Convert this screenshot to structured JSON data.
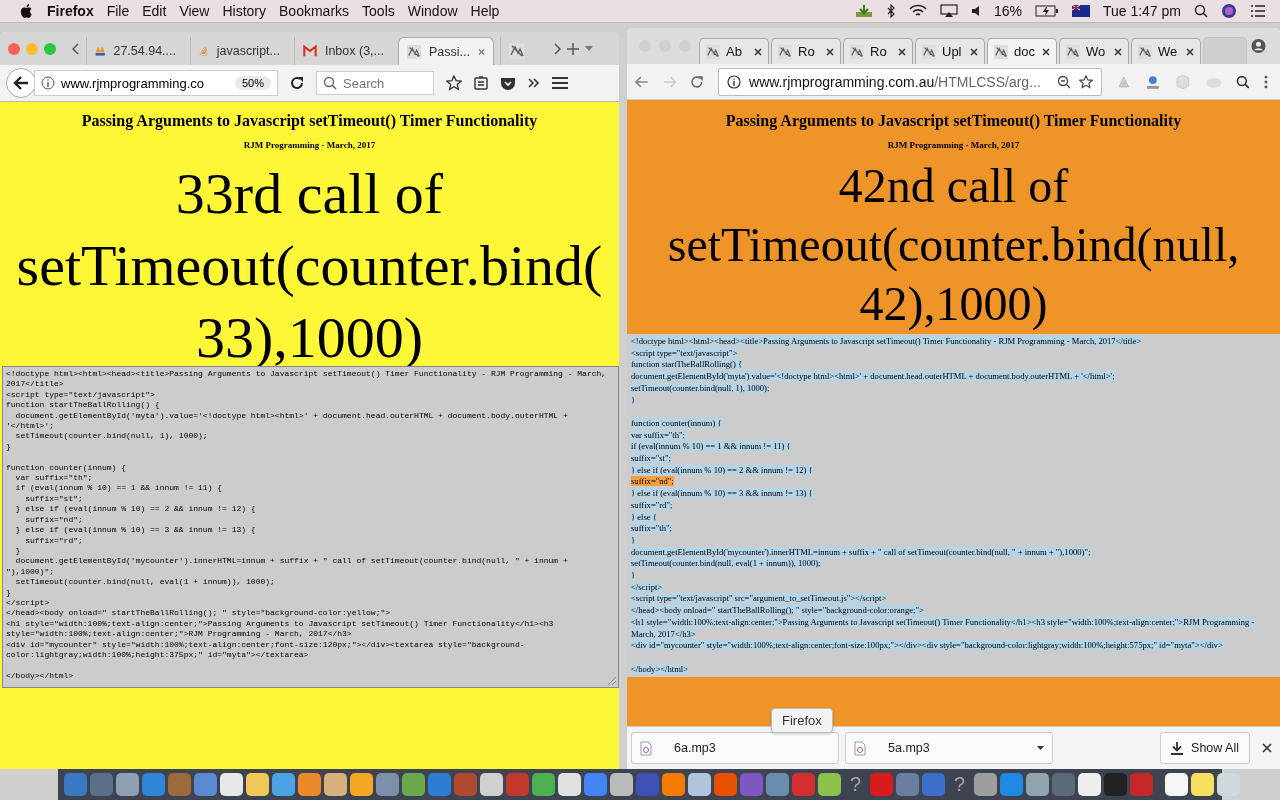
{
  "menu_bar": {
    "app": "Firefox",
    "menus": [
      "File",
      "Edit",
      "View",
      "History",
      "Bookmarks",
      "Tools",
      "Window",
      "Help"
    ],
    "battery": "16%",
    "clock": "Tue 1:47 pm"
  },
  "firefox_window": {
    "tabs": [
      {
        "label": "27.54.94....",
        "kind": "pma",
        "selected": false
      },
      {
        "label": "javascript...",
        "kind": "stack",
        "selected": false
      },
      {
        "label": "Inbox (3,...",
        "kind": "mail",
        "selected": false
      },
      {
        "label": "Passi...",
        "kind": "site",
        "selected": true
      }
    ],
    "address": "www.rjmprogramming.co",
    "zoom": "50%",
    "search": {
      "placeholder": "Search"
    },
    "page": {
      "heading": "Passing Arguments to Javascript setTimeout() Timer Functionality",
      "subheading": "RJM Programming - March, 2017",
      "counter_lines": [
        "33rd call of",
        "setTimeout(counter.bind(",
        "33),1000)"
      ],
      "code": "<!doctype html><html><head><title>Passing Arguments to Javascript setTimeout() Timer Functionality - RJM Programming - March, 2017</title>\n<script type=\"text/javascript\">\nfunction startTheBallRolling() {\n  document.getElementById('myta').value='<!doctype html><html>' + document.head.outerHTML + document.body.outerHTML + '</html>';\n  setTimeout(counter.bind(null, 1), 1000);\n}\n\nfunction counter(innum) {\n  var suffix=\"th\";\n  if (eval(innum % 10) == 1 && innum != 11) {\n    suffix=\"st\";\n  } else if (eval(innum % 10) == 2 && innum != 12) {\n    suffix=\"nd\";\n  } else if (eval(innum % 10) == 3 && innum != 13) {\n    suffix=\"rd\";\n  }\n  document.getElementById('mycounter').innerHTML=innum + suffix + \" call of setTimeout(counter.bind(null, \" + innum + \"),1000)\";\n  setTimeout(counter.bind(null, eval(1 + innum)), 1000);\n}\n</script>\n</head><body onload=\" startTheBallRolling(); \" style=\"background-color:yellow;\">\n<h1 style=\"width:100%;text-align:center;\">Passing Arguments to Javascript setTimeout() Timer Functionality</h1><h3 style=\"width:100%;text-align:center;\">RJM Programming - March, 2017</h3>\n<div id=\"mycounter\" style=\"width:100%;text-align:center;font-size:120px;\"></div><textarea style=\"background-color:lightgray;width:100%;height:375px;\" id=\"myta\"></textarea>\n\n</body></html>"
    }
  },
  "chrome_window": {
    "tabs": [
      {
        "label": "Ab",
        "selected": false
      },
      {
        "label": "Ro",
        "selected": false
      },
      {
        "label": "Ro",
        "selected": false
      },
      {
        "label": "Upl",
        "selected": false
      },
      {
        "label": "doc",
        "selected": true
      },
      {
        "label": "Wo",
        "selected": false
      },
      {
        "label": "We",
        "selected": false
      }
    ],
    "address_host": "www.rjmprogramming.com.au",
    "address_path": "/HTMLCSS/arg...",
    "page": {
      "heading": "Passing Arguments to Javascript setTimeout() Timer Functionality",
      "subheading": "RJM Programming - March, 2017",
      "counter_lines": [
        "42nd call of",
        "setTimeout(counter.bind(null,",
        "42),1000)"
      ],
      "code_blocks": [
        {
          "text": "<!doctype html><html><head><title>Passing Arguments to Javascript setTimeout() Timer Functionality - RJM Programming - March, 2017</title>\n<script type=\"text/javascript\">\nfunction startTheBallRolling() {\ndocument.getElementById('myta').value='<!doctype html><html>' + document.head.outerHTML + document.body.outerHTML + '</html>';\nsetTimeout(counter.bind(null, 1), 1000);\n}\n\nfunction counter(innum) {\nvar suffix=\"th\";\nif (eval(innum % 10) == 1 && innum != 11) {\nsuffix=\"st\";\n} else if (eval(innum % 10) == 2 && innum != 12) {\n",
          "match": false
        },
        {
          "text": "suffix=\"nd\";",
          "match": true
        },
        {
          "text": "\n} else if (eval(innum % 10) == 3 && innum != 13) {\nsuffix=\"rd\";\n} else {\nsuffix=\"th\";\n}\ndocument.getElementById('mycounter').innerHTML=innum + suffix + \" call of setTimeout(counter.bind(null, \" + innum + \"),1000)\";\nsetTimeout(counter.bind(null, eval(1 + innum)), 1000);\n}\n</script>\n<script type=\"text/javascript\" src=\"argument_to_setTimeout.js\"></script>\n</head><body onload=\" startTheBallRolling(); \" style=\"background-color:orange;\">\n<h1 style=\"width:100%;text-align:center;\">Passing Arguments to Javascript setTimeout() Timer Functionality</h1><h3 style=\"width:100%;text-align:center;\">RJM Programming - March, 2017</h3>\n<div id=\"mycounter\" style=\"width:100%;text-align:center;font-size:100px;\"></div><div style=\"background-color:lightgray;width:100%;height:575px;\" id=\"myta\"></div>\n\n</body></html>",
          "match": false
        }
      ]
    },
    "downloads": [
      {
        "file": "6a.mp3"
      },
      {
        "file": "5a.mp3"
      }
    ],
    "show_all": "Show All"
  },
  "tooltip": "Firefox",
  "dock": [
    {
      "kind": "app",
      "color": "#3a78c2"
    },
    {
      "kind": "app",
      "color": "#5a6f8a"
    },
    {
      "kind": "app",
      "color": "#8fa0b5"
    },
    {
      "kind": "app",
      "color": "#2f86d8"
    },
    {
      "kind": "app",
      "color": "#9a6a3a"
    },
    {
      "kind": "app",
      "color": "#5b8ad0"
    },
    {
      "kind": "app",
      "color": "#e8e8e8"
    },
    {
      "kind": "app",
      "color": "#f0c85a"
    },
    {
      "kind": "app",
      "color": "#4ba3e3"
    },
    {
      "kind": "app",
      "color": "#ea8a2c"
    },
    {
      "kind": "app",
      "color": "#d8b27c"
    },
    {
      "kind": "app",
      "color": "#f5a623"
    },
    {
      "kind": "app",
      "color": "#7b8fa8"
    },
    {
      "kind": "app",
      "color": "#6aa84f"
    },
    {
      "kind": "app",
      "color": "#2d7dd2"
    },
    {
      "kind": "app",
      "color": "#b04a2f"
    },
    {
      "kind": "app",
      "color": "#d0d0d0"
    },
    {
      "kind": "app",
      "color": "#c0392b"
    },
    {
      "kind": "app",
      "color": "#4caf50"
    },
    {
      "kind": "app",
      "color": "#e0e0e0"
    },
    {
      "kind": "app",
      "color": "#4285f4"
    },
    {
      "kind": "app",
      "color": "#bbbbbb"
    },
    {
      "kind": "app",
      "color": "#3f51b5"
    },
    {
      "kind": "app",
      "color": "#f57c00"
    },
    {
      "kind": "app",
      "color": "#b0c4de"
    },
    {
      "kind": "app",
      "color": "#e65100"
    },
    {
      "kind": "app",
      "color": "#7e57c2"
    },
    {
      "kind": "app",
      "color": "#6a8caf"
    },
    {
      "kind": "app",
      "color": "#d32f2f"
    },
    {
      "kind": "app",
      "color": "#8bc34a"
    },
    {
      "kind": "unknown",
      "symbol": "?"
    },
    {
      "kind": "app",
      "color": "#d81b1b"
    },
    {
      "kind": "app",
      "color": "#6a7fa0"
    },
    {
      "kind": "app",
      "color": "#3b6fc9"
    },
    {
      "kind": "unknown",
      "symbol": "?"
    },
    {
      "kind": "app",
      "color": "#9e9e9e"
    },
    {
      "kind": "app",
      "color": "#1e88e5"
    },
    {
      "kind": "app",
      "color": "#90a4ae"
    },
    {
      "kind": "app",
      "color": "#5a6a78"
    },
    {
      "kind": "app",
      "color": "#eeeeee"
    },
    {
      "kind": "app",
      "color": "#222222"
    },
    {
      "kind": "app",
      "color": "#c62828"
    },
    {
      "kind": "separator"
    },
    {
      "kind": "app",
      "color": "#f5f5f5"
    },
    {
      "kind": "app",
      "color": "#f6e05e"
    },
    {
      "kind": "app",
      "color": "#cfd8dc"
    }
  ]
}
